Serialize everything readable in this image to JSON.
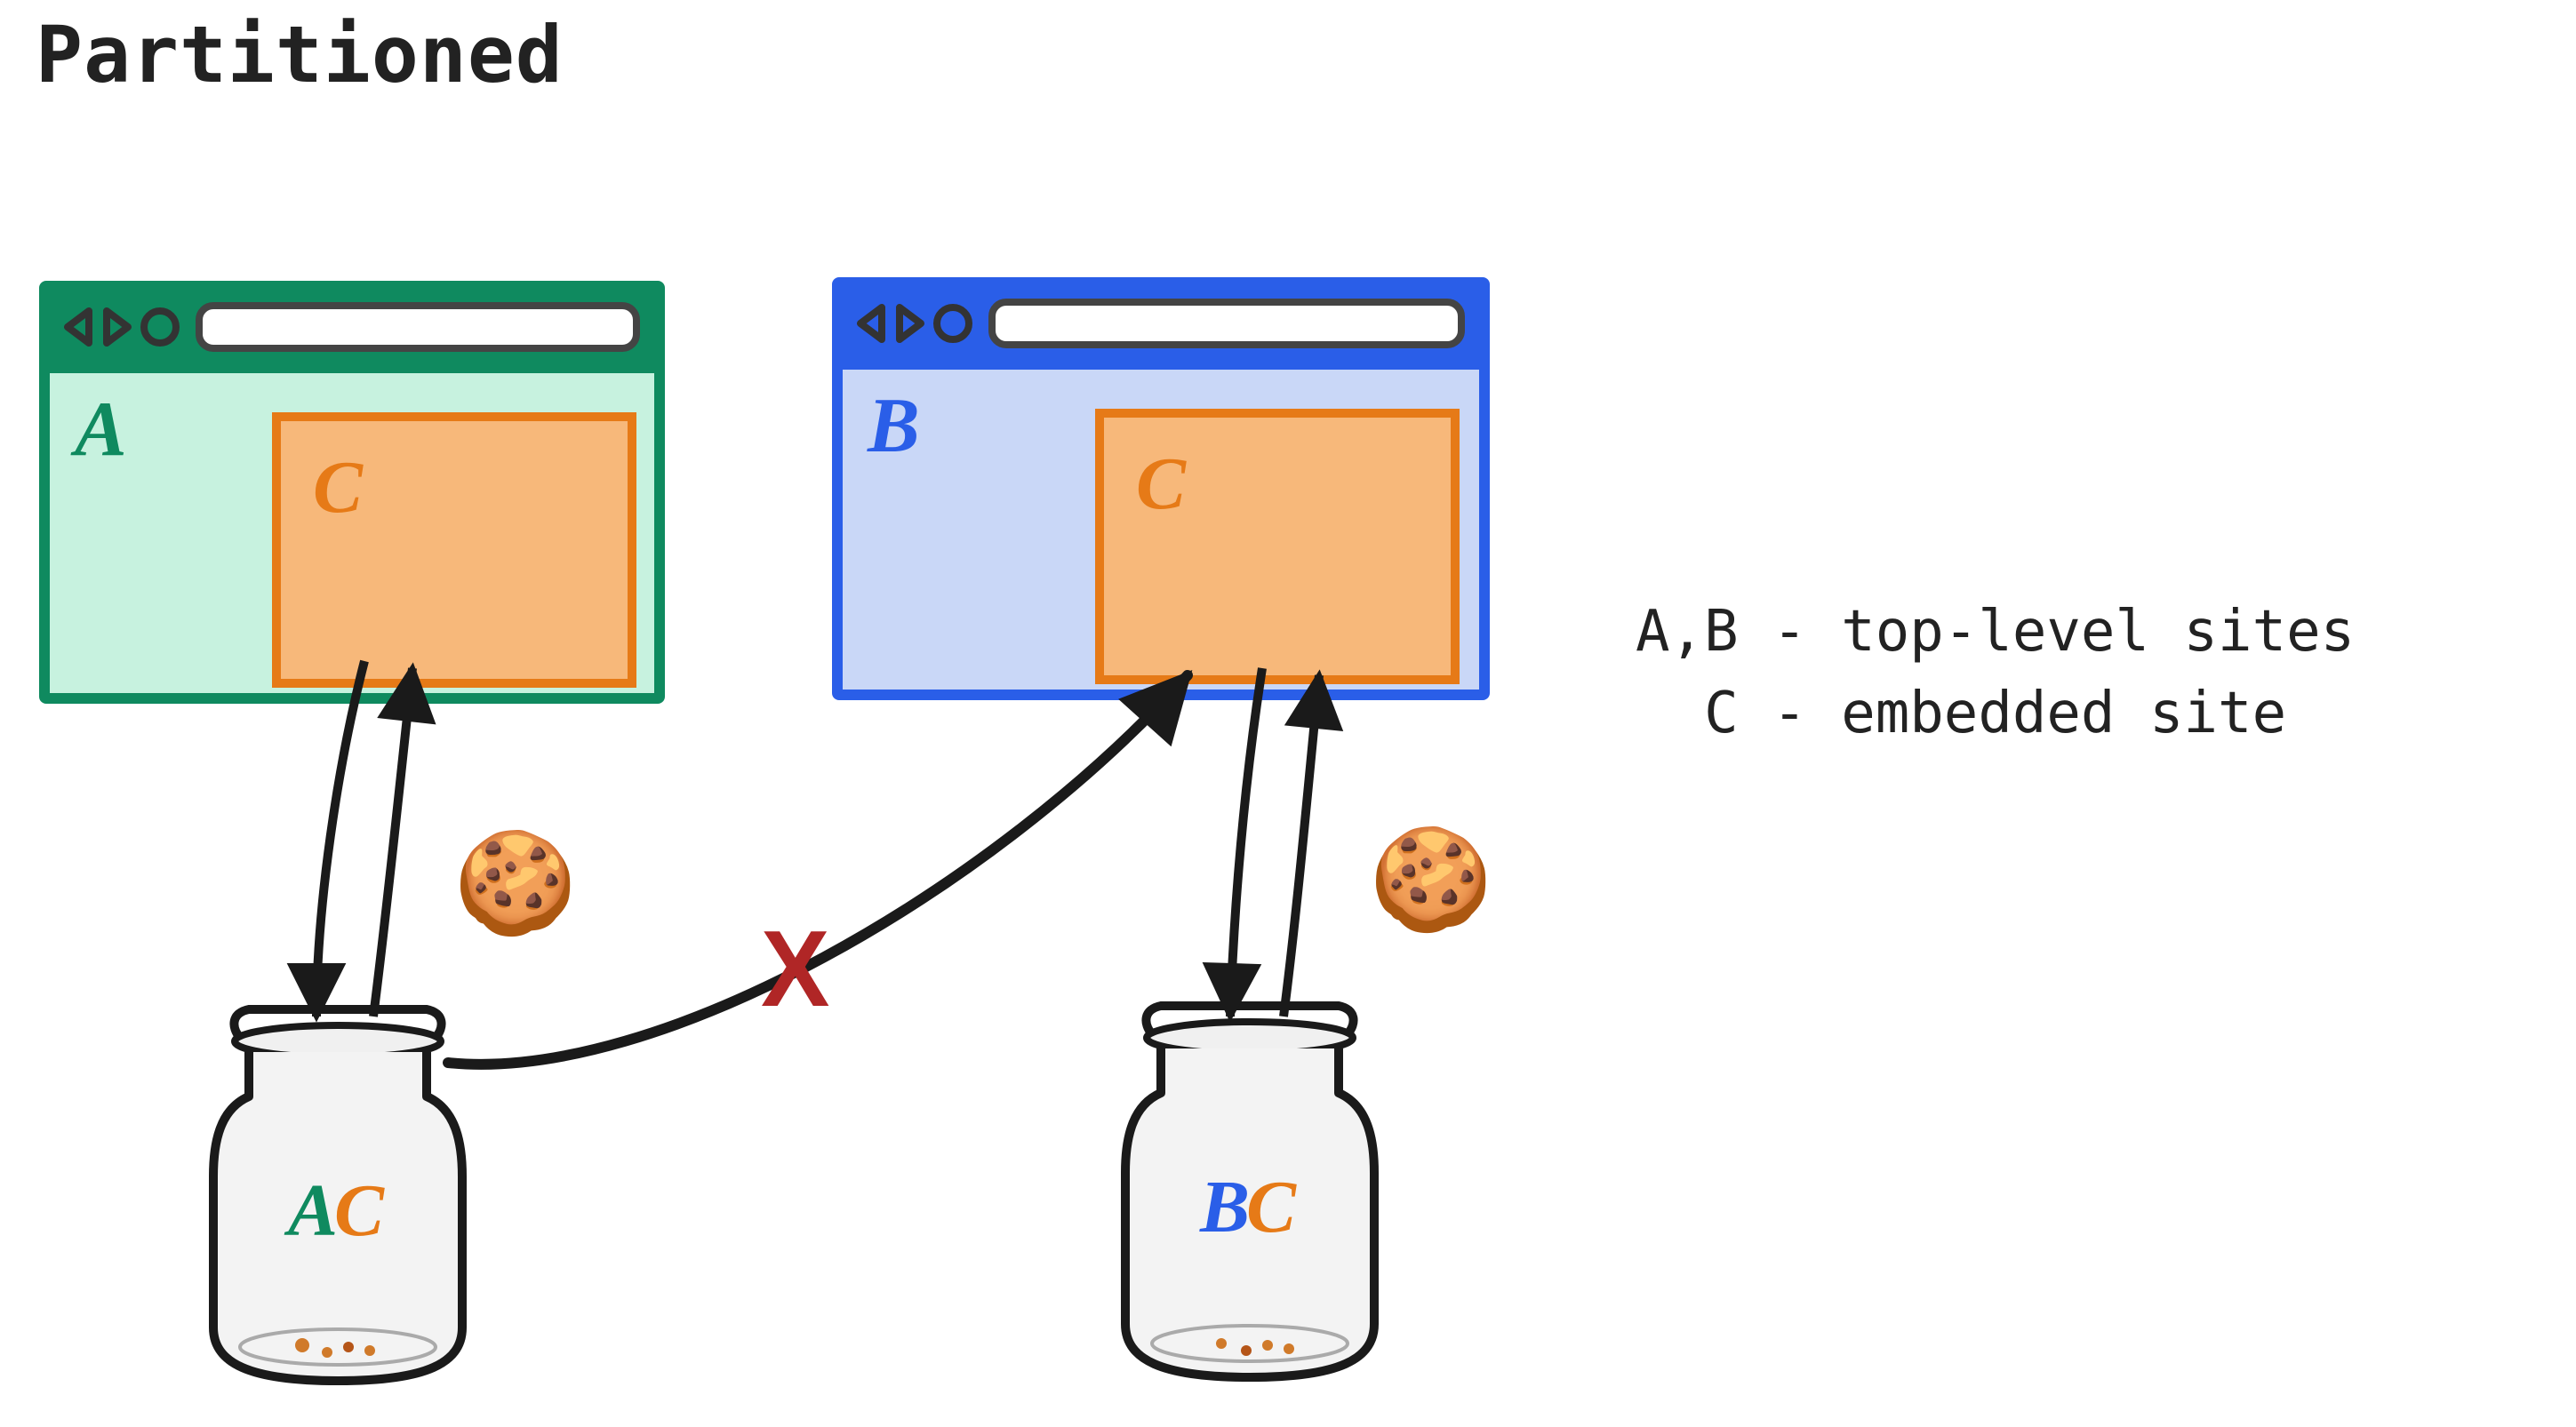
{
  "title": "Partitioned",
  "legend": {
    "line1": "A,B - top-level sites",
    "line2": "  C - embedded site"
  },
  "colors": {
    "siteA": "#0f8a5f",
    "siteA_fill": "#c7f2df",
    "siteB": "#2a5ee8",
    "siteB_fill": "#c9d7f7",
    "embedC": "#e67a17",
    "embedC_fill": "#f7b87a",
    "ink": "#1a1a1a",
    "blocked": "#b02626"
  },
  "browsers": {
    "A": {
      "label": "A",
      "embed_label": "C"
    },
    "B": {
      "label": "B",
      "embed_label": "C"
    }
  },
  "jars": {
    "left": {
      "label_a": "A",
      "label_b": "C"
    },
    "right": {
      "label_a": "B",
      "label_b": "C"
    }
  },
  "icons": {
    "cookie": "🍪"
  },
  "blocked_mark": "X"
}
